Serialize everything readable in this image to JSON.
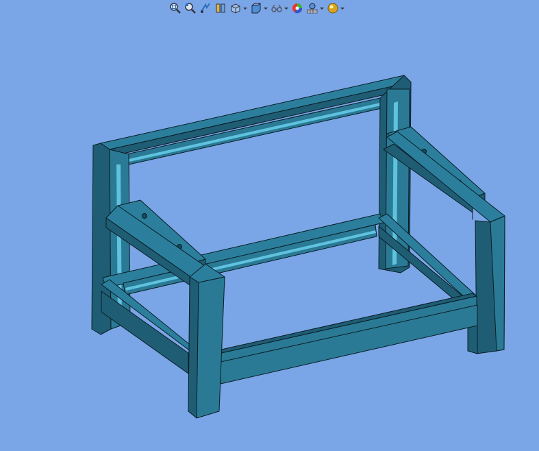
{
  "app": {
    "view": "3d-graphics-area"
  },
  "colors": {
    "background": "#7aa5e6",
    "face_top": "#2b7f9c",
    "face_front": "#2a7a95",
    "face_side": "#1f5d75",
    "face_dark": "#174a5e",
    "highlight": "#5fc2df",
    "edge": "#0a1c24"
  },
  "toolbar": {
    "items": [
      {
        "icon": "zoom-to-fit-icon",
        "dropdown": false
      },
      {
        "icon": "zoom-to-area-icon",
        "dropdown": false
      },
      {
        "icon": "previous-view-icon",
        "dropdown": false
      },
      {
        "icon": "section-view-icon",
        "dropdown": false
      },
      {
        "icon": "view-orientation-icon",
        "dropdown": true
      },
      {
        "icon": "display-style-icon",
        "dropdown": true
      },
      {
        "icon": "hide-show-items-icon",
        "dropdown": true
      },
      {
        "icon": "edit-appearance-icon",
        "dropdown": false
      },
      {
        "icon": "apply-scene-icon",
        "dropdown": true
      },
      {
        "icon": "view-settings-icon",
        "dropdown": true
      }
    ]
  }
}
